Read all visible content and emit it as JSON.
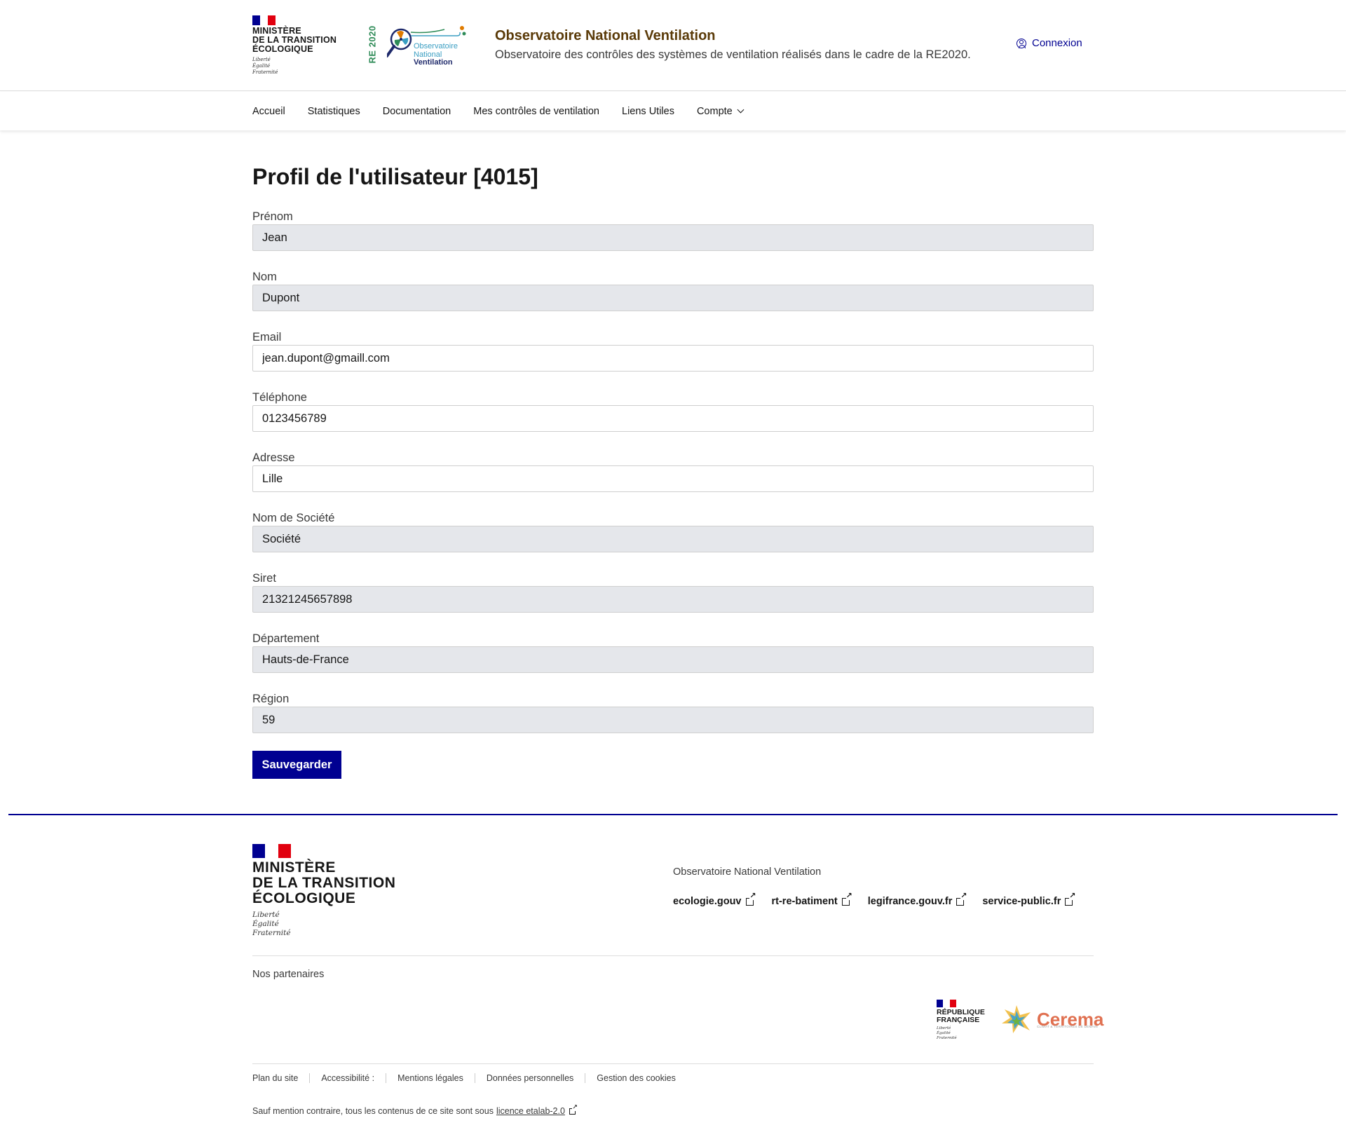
{
  "header": {
    "ministry_title": [
      "Ministère",
      "de la transition",
      "écologique"
    ],
    "devise": [
      "Liberté",
      "Égalité",
      "Fraternité"
    ],
    "onv_logo": {
      "badge": "RE 2020",
      "line1": "Observatoire",
      "line2": "National",
      "line3": "Ventilation"
    },
    "site_title": "Observatoire National Ventilation",
    "site_tagline": "Observatoire des contrôles des systèmes de ventilation réalisés dans le cadre de la RE2020.",
    "login_label": "Connexion"
  },
  "nav": {
    "items": [
      {
        "label": "Accueil"
      },
      {
        "label": "Statistiques"
      },
      {
        "label": "Documentation"
      },
      {
        "label": "Mes contrôles de ventilation"
      },
      {
        "label": "Liens Utiles"
      },
      {
        "label": "Compte"
      }
    ]
  },
  "form": {
    "title": "Profil de l'utilisateur [4015]",
    "fields": [
      {
        "label": "Prénom",
        "value": "Jean",
        "readonly": true
      },
      {
        "label": "Nom",
        "value": "Dupont",
        "readonly": true
      },
      {
        "label": "Email",
        "value": "jean.dupont@gmaill.com",
        "readonly": false
      },
      {
        "label": "Téléphone",
        "value": "0123456789",
        "readonly": false
      },
      {
        "label": "Adresse",
        "value": "Lille",
        "readonly": false
      },
      {
        "label": "Nom de Société",
        "value": "Société",
        "readonly": true
      },
      {
        "label": "Siret",
        "value": "21321245657898",
        "readonly": true
      },
      {
        "label": "Département",
        "value": "Hauts-de-France",
        "readonly": true
      },
      {
        "label": "Région",
        "value": "59",
        "readonly": true
      }
    ],
    "save_label": "Sauvegarder"
  },
  "footer": {
    "ministry_title": [
      "Ministère",
      "de la transition",
      "écologique"
    ],
    "devise": [
      "Liberté",
      "Égalité",
      "Fraternité"
    ],
    "description": "Observatoire National Ventilation",
    "links": [
      {
        "label": "ecologie.gouv"
      },
      {
        "label": "rt-re-batiment"
      },
      {
        "label": "legifrance.gouv.fr"
      },
      {
        "label": "service-public.fr"
      }
    ],
    "partners_title": "Nos partenaires",
    "partner_rf": {
      "title": [
        "République",
        "Française"
      ],
      "devise": [
        "Liberté",
        "Égalité",
        "Fraternité"
      ]
    },
    "partner_cerema": {
      "name": "Cerema",
      "sub": "CLIMAT & TERRITOIRES DE DEMAIN"
    },
    "bottom_links": [
      {
        "label": "Plan du site"
      },
      {
        "label": "Accessibilité :"
      },
      {
        "label": "Mentions légales"
      },
      {
        "label": "Données personnelles"
      },
      {
        "label": "Gestion des cookies"
      }
    ],
    "licence_text": "Sauf mention contraire, tous les contenus de ce site sont sous",
    "licence_link": "licence etalab-2.0"
  },
  "colors": {
    "primary_blue": "#000091",
    "flag_red": "#e1000f",
    "readonly_bg": "#e5e7eb",
    "site_title_brown": "#5a3a08",
    "cerema_orange": "#e07050"
  },
  "icons": [
    "user-circle-icon",
    "chevron-down-icon",
    "external-link-icon"
  ]
}
